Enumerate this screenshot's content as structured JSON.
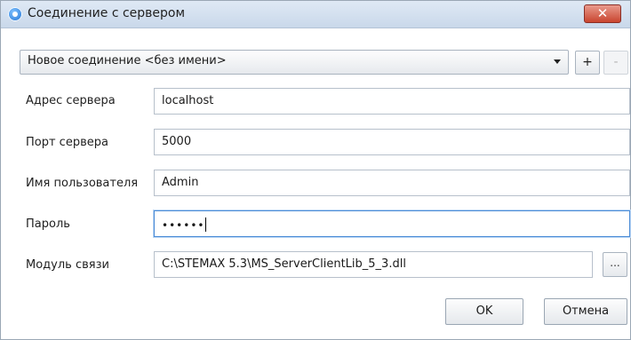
{
  "window": {
    "title": "Соединение с сервером",
    "close_glyph": "✕"
  },
  "connection": {
    "selected": "Новое соединение <без имени>",
    "add_label": "+",
    "remove_label": "-"
  },
  "form": {
    "server_address_label": "Адрес сервера",
    "server_address_value": "localhost",
    "server_port_label": "Порт сервера",
    "server_port_value": "5000",
    "username_label": "Имя пользователя",
    "username_value": "Admin",
    "password_label": "Пароль",
    "password_value": "••••••",
    "module_label": "Модуль связи",
    "module_value": "C:\\STEMAX 5.3\\MS_ServerClientLib_5_3.dll",
    "browse_label": "..."
  },
  "buttons": {
    "ok_label": "OK",
    "cancel_label": "Отмена"
  },
  "colors": {
    "titlebar": "#c9d8ea",
    "close": "#c9452f",
    "focus": "#4a8bd6"
  }
}
